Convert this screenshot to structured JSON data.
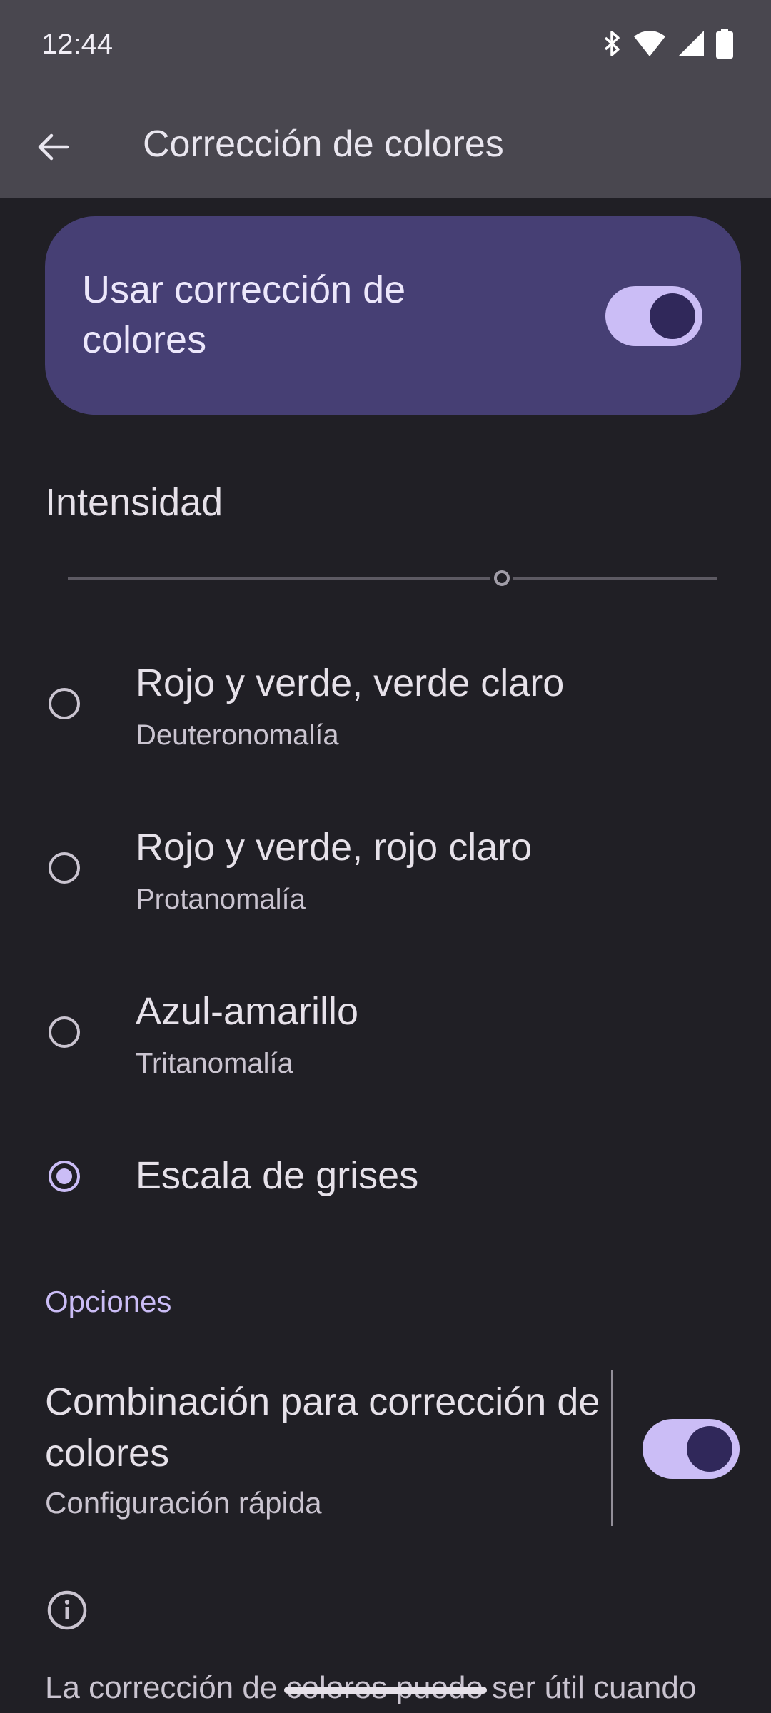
{
  "status_bar": {
    "time": "12:44"
  },
  "app_bar": {
    "title": "Corrección de colores"
  },
  "main_toggle": {
    "label": "Usar corrección de colores",
    "checked": true
  },
  "intensity": {
    "label": "Intensidad",
    "value_fraction": 0.67
  },
  "options": [
    {
      "title": "Rojo y verde, verde claro",
      "subtitle": "Deuteronomalía",
      "selected": false
    },
    {
      "title": "Rojo y verde, rojo claro",
      "subtitle": "Protanomalía",
      "selected": false
    },
    {
      "title": "Azul-amarillo",
      "subtitle": "Tritanomalía",
      "selected": false
    },
    {
      "title": "Escala de grises",
      "subtitle": "",
      "selected": true
    }
  ],
  "section": {
    "header": "Opciones"
  },
  "shortcut": {
    "title": "Combinación para corrección de colores",
    "subtitle": "Configuración rápida",
    "checked": true
  },
  "footer": {
    "text": "La corrección de colores puede ser útil cuando"
  },
  "icons": [
    "back-arrow-icon",
    "bluetooth-icon",
    "wifi-icon",
    "signal-icon",
    "battery-icon",
    "info-icon"
  ],
  "colors": {
    "accent": "#cbbdf6",
    "card": "#463f74",
    "background": "#201f25",
    "topbar": "#49474f"
  }
}
